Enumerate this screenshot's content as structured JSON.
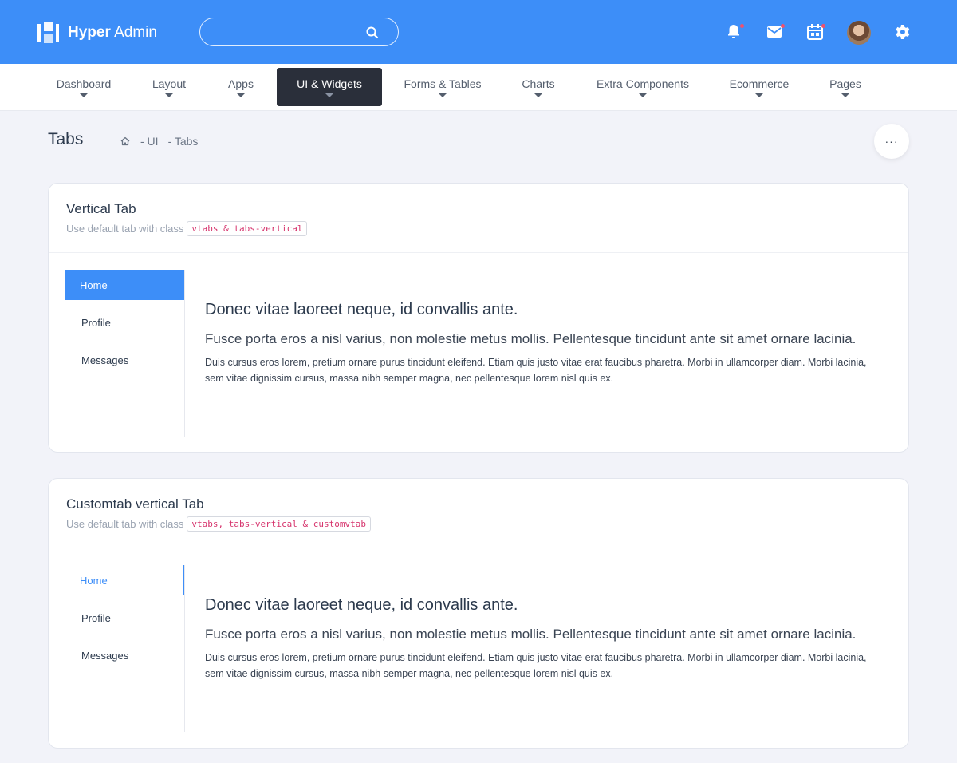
{
  "app": {
    "brand_bold": "Hyper",
    "brand_light": "Admin"
  },
  "search": {
    "placeholder": "",
    "value": ""
  },
  "topbar_icons": [
    "bell-icon",
    "mail-icon",
    "calendar-icon",
    "avatar",
    "gear-icon"
  ],
  "nav": {
    "items": [
      {
        "label": "Dashboard"
      },
      {
        "label": "Layout"
      },
      {
        "label": "Apps"
      },
      {
        "label": "UI & Widgets"
      },
      {
        "label": "Forms & Tables"
      },
      {
        "label": "Charts"
      },
      {
        "label": "Extra Components"
      },
      {
        "label": "Ecommerce"
      },
      {
        "label": "Pages"
      }
    ],
    "active": "UI & Widgets"
  },
  "page": {
    "title": "Tabs",
    "breadcrumb": [
      "- UI",
      "- Tabs"
    ],
    "more_label": "···"
  },
  "cards": [
    {
      "title": "Vertical Tab",
      "subtitle": "Use default tab with class",
      "code": "vtabs & tabs-vertical",
      "tabs": [
        "Home",
        "Profile",
        "Messages"
      ],
      "active_tab": "Home",
      "content": {
        "heading": "Donec vitae laoreet neque, id convallis ante.",
        "subheading": "Fusce porta eros a nisl varius, non molestie metus mollis. Pellentesque tincidunt ante sit amet ornare lacinia.",
        "body": "Duis cursus eros lorem, pretium ornare purus tincidunt eleifend. Etiam quis justo vitae erat faucibus pharetra. Morbi in ullamcorper diam. Morbi lacinia, sem vitae dignissim cursus, massa nibh semper magna, nec pellentesque lorem nisl quis ex."
      }
    },
    {
      "title": "Customtab vertical Tab",
      "subtitle": "Use default tab with class",
      "code": "vtabs, tabs-vertical & customvtab",
      "tabs": [
        "Home",
        "Profile",
        "Messages"
      ],
      "active_tab": "Home",
      "content": {
        "heading": "Donec vitae laoreet neque, id convallis ante.",
        "subheading": "Fusce porta eros a nisl varius, non molestie metus mollis. Pellentesque tincidunt ante sit amet ornare lacinia.",
        "body": "Duis cursus eros lorem, pretium ornare purus tincidunt eleifend. Etiam quis justo vitae erat faucibus pharetra. Morbi in ullamcorper diam. Morbi lacinia, sem vitae dignissim cursus, massa nibh semper magna, nec pellentesque lorem nisl quis ex."
      }
    }
  ],
  "colors": {
    "primary": "#3d8ef8",
    "nav_active": "#2a2f3a",
    "badge": "#f0506e",
    "code": "#d6336c"
  }
}
